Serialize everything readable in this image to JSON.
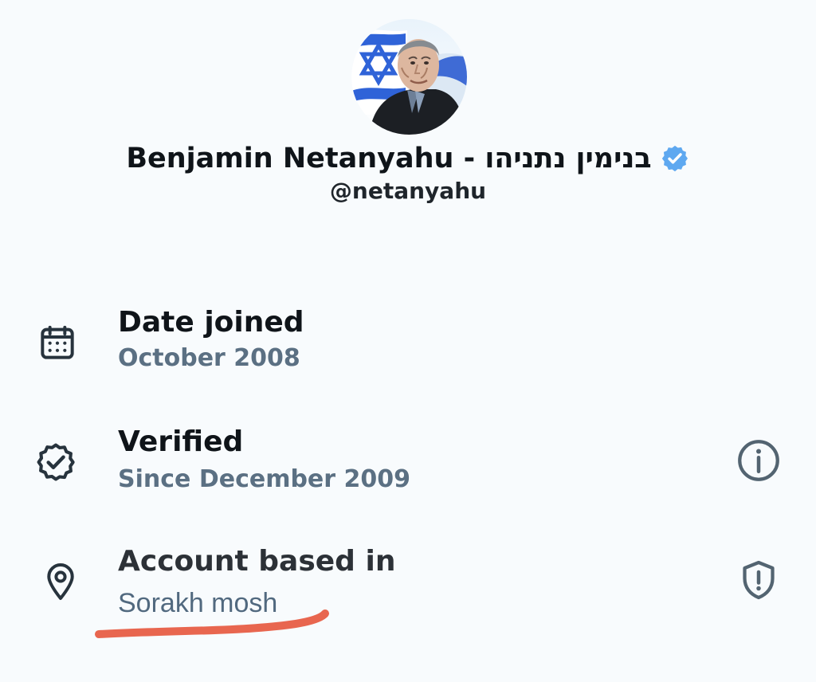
{
  "profile": {
    "avatar_label": "profile photo",
    "display_name": "Benjamin Netanyahu - בנימין נתניהו",
    "verified_badge": "verified-badge-icon",
    "handle": "@netanyahu",
    "accent_color": "#1d9bf0"
  },
  "rows": [
    {
      "icon": "calendar-icon",
      "title": "Date joined",
      "subtitle": "October 2008"
    },
    {
      "icon": "verified-seal-icon",
      "title": "Verified",
      "subtitle": "Since December 2009",
      "action_icon": "info-icon"
    },
    {
      "icon": "location-pin-icon",
      "title": "Account based in",
      "subtitle": "Sorakh mosh",
      "action_icon": "shield-alert-icon"
    }
  ],
  "colors": {
    "background": "#f8fbfd",
    "primary_text": "#0f1419",
    "secondary_text": "#5b7083",
    "icon_color": "#536471",
    "underline_annotation": "#e8664f"
  }
}
